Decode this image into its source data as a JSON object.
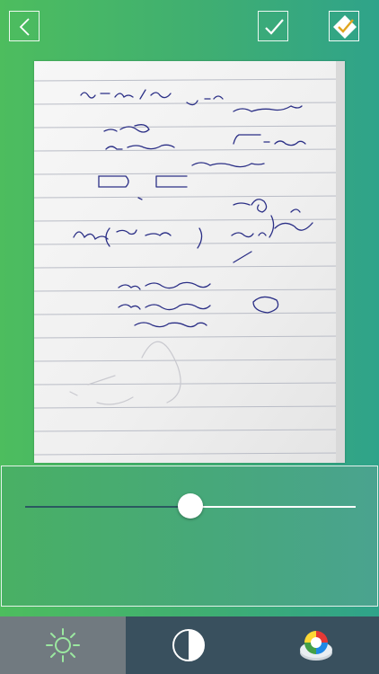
{
  "toolbar": {
    "back_icon": "chevron-left-icon",
    "confirm_icon": "check-icon",
    "crop_icon": "diamond-check-icon"
  },
  "adjustment": {
    "value": 0.5,
    "track_color": "#ffffff",
    "fill_color": "#2a5960"
  },
  "tabs": [
    {
      "icon": "sun-icon",
      "selected": true
    },
    {
      "icon": "contrast-icon",
      "selected": false
    },
    {
      "icon": "color-wheel-icon",
      "selected": false
    }
  ],
  "colors": {
    "accent_green": "#4dbd5e",
    "accent_teal": "#2fa38a",
    "tabbar_bg": "#39505e",
    "tab_selected_bg": "#717a80",
    "sun_icon": "#9be8a0"
  }
}
